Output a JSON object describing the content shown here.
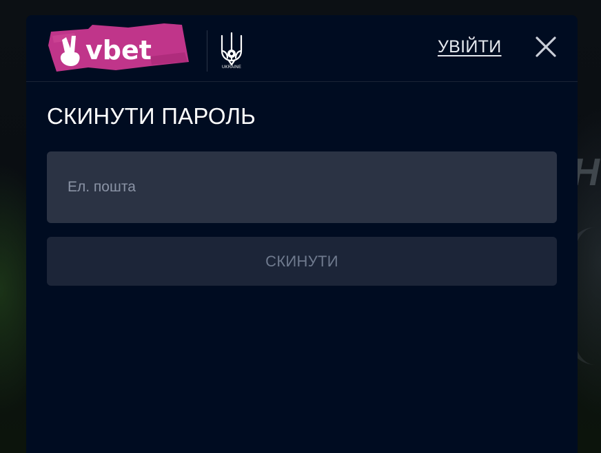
{
  "brand": {
    "name": "vbet",
    "federation_label": "UKRAINE",
    "accent_color": "#c0358a"
  },
  "header": {
    "login_label": "УВІЙТИ",
    "close_icon": "close-icon"
  },
  "form": {
    "title": "СКИНУТИ ПАРОЛЬ",
    "email_placeholder": "Ел. пошта",
    "email_value": "",
    "submit_label": "СКИНУТИ"
  },
  "colors": {
    "modal_background": "#000c21",
    "input_background": "#2b3344",
    "button_background": "#1c2538",
    "button_text": "#6f7a8e"
  }
}
